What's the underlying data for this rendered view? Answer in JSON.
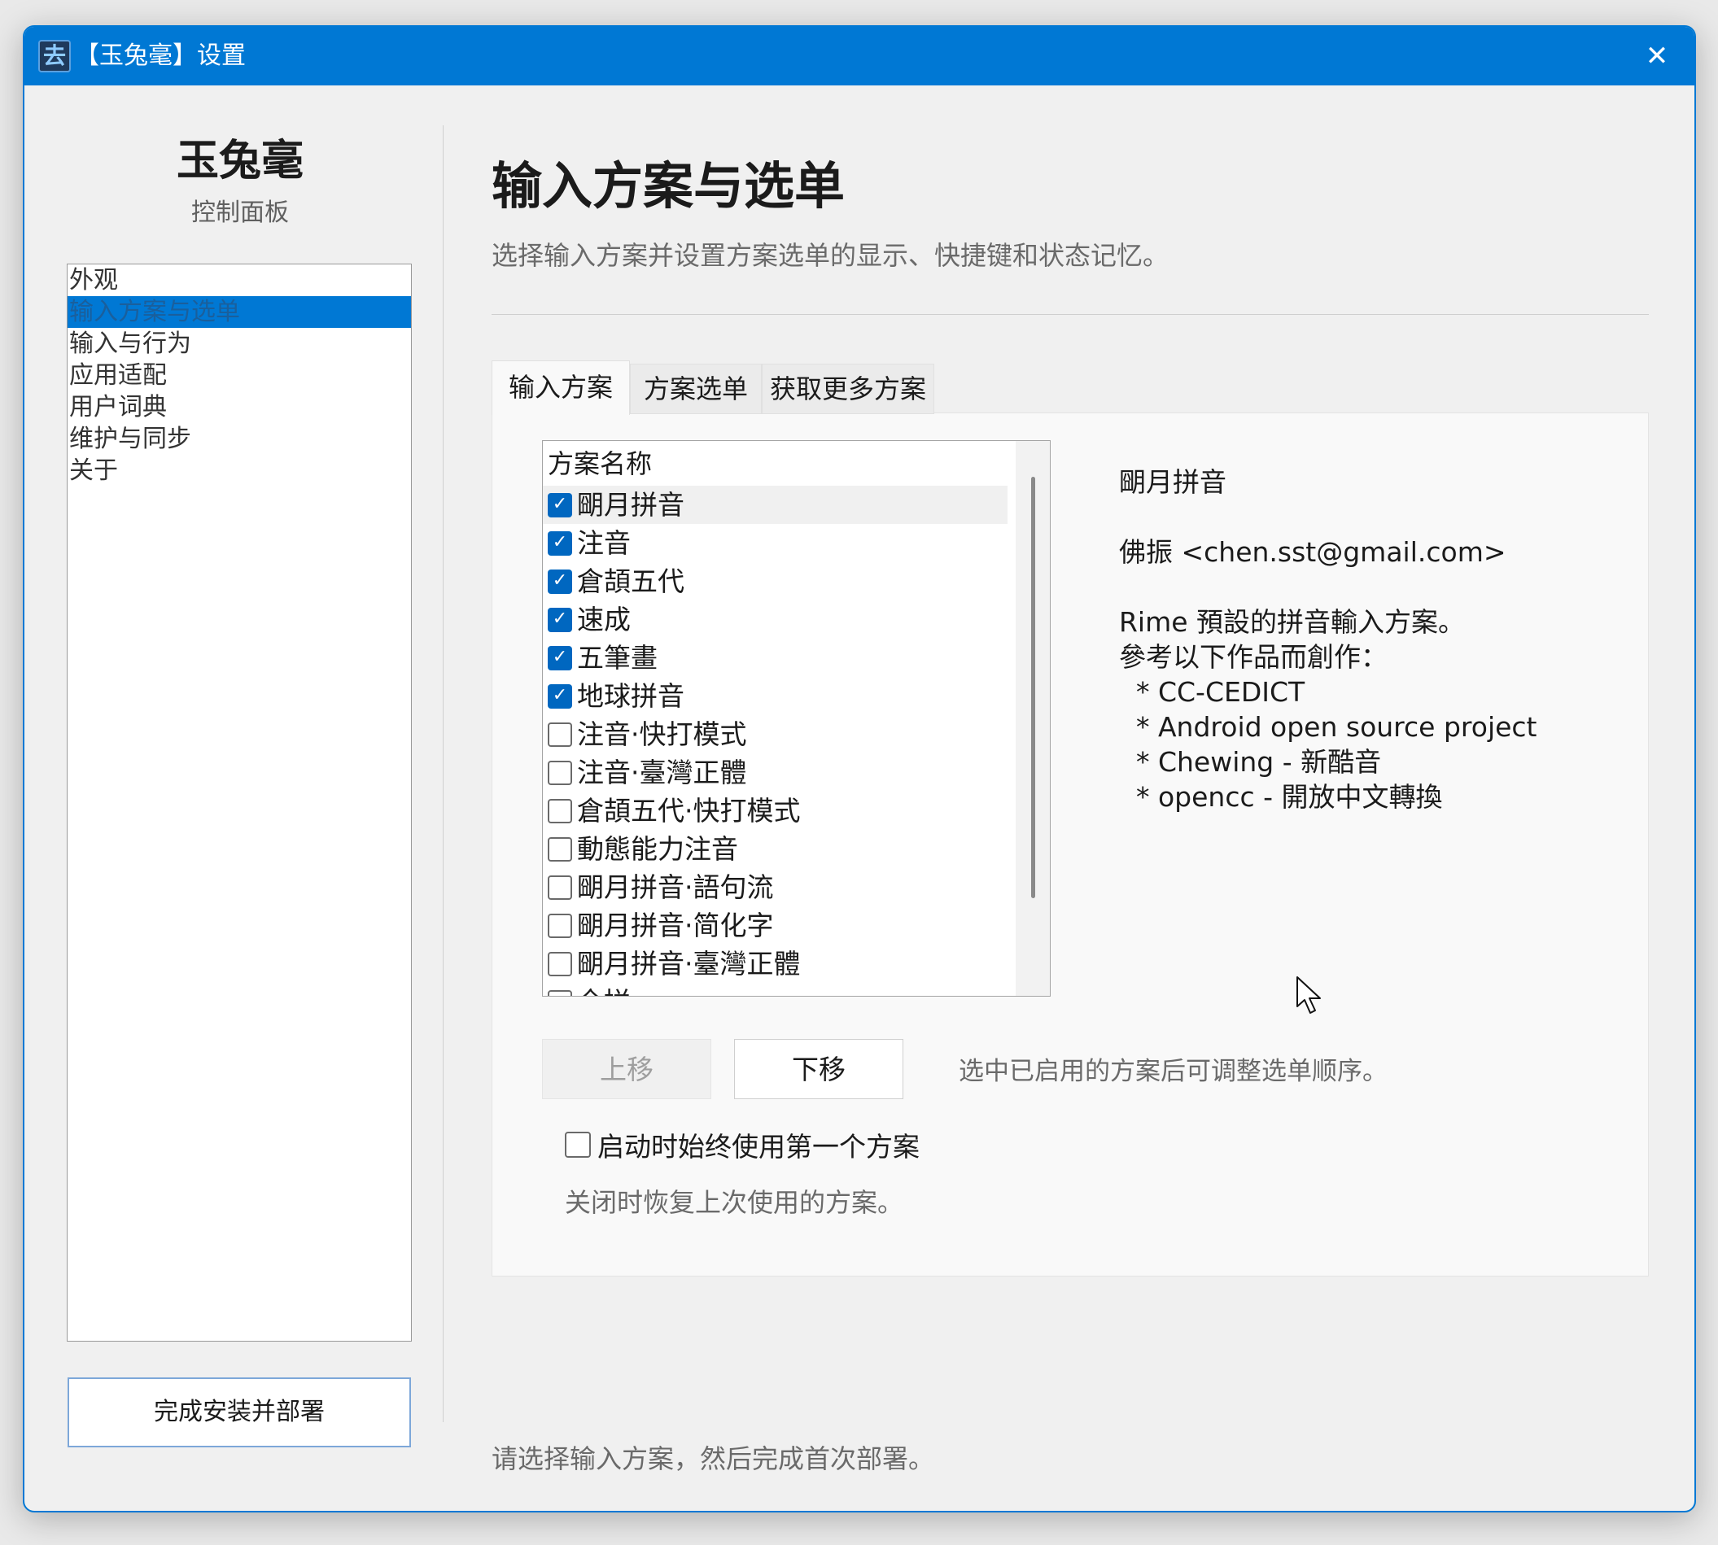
{
  "titlebar": {
    "icon_glyph": "去",
    "title": "【玉兔毫】设置",
    "close_glyph": "✕"
  },
  "sidebar": {
    "brand": "玉兔毫",
    "subtitle": "控制面板",
    "items": [
      {
        "label": "外观"
      },
      {
        "label": "输入方案与选单",
        "active": true
      },
      {
        "label": "输入与行为"
      },
      {
        "label": "应用适配"
      },
      {
        "label": "用户词典"
      },
      {
        "label": "维护与同步"
      },
      {
        "label": "关于"
      }
    ],
    "finish_button": "完成安装并部署"
  },
  "main": {
    "title": "输入方案与选单",
    "description": "选择输入方案并设置方案选单的显示、快捷键和状态记忆。",
    "tabs": [
      {
        "label": "输入方案",
        "active": true
      },
      {
        "label": "方案选单"
      },
      {
        "label": "获取更多方案"
      }
    ],
    "schema_list": {
      "header": "方案名称",
      "rows": [
        {
          "label": "朙月拼音",
          "checked": true
        },
        {
          "label": "注音",
          "checked": true
        },
        {
          "label": "倉頡五代",
          "checked": true
        },
        {
          "label": "速成",
          "checked": true
        },
        {
          "label": "五筆畫",
          "checked": true
        },
        {
          "label": "地球拼音",
          "checked": true
        },
        {
          "label": "注音·快打模式",
          "checked": false
        },
        {
          "label": "注音·臺灣正體",
          "checked": false
        },
        {
          "label": "倉頡五代·快打模式",
          "checked": false
        },
        {
          "label": "動態能力注音",
          "checked": false
        },
        {
          "label": "朙月拼音·語句流",
          "checked": false
        },
        {
          "label": "朙月拼音·简化字",
          "checked": false
        },
        {
          "label": "朙月拼音·臺灣正體",
          "checked": false
        },
        {
          "label": "全拼",
          "checked": false
        }
      ]
    },
    "detail": {
      "name": "朙月拼音",
      "author": "佛振 <chen.sst@gmail.com>",
      "desc_lines": [
        "Rime 預設的拼音輸入方案。",
        "參考以下作品而創作：",
        "  * CC-CEDICT",
        "  * Android open source project",
        "  * Chewing - 新酷音",
        "  * opencc - 開放中文轉換"
      ]
    },
    "move_up": "上移",
    "move_down": "下移",
    "order_hint": "选中已启用的方案后可调整选单顺序。",
    "startup_checkbox": {
      "label": "启动时始终使用第一个方案",
      "checked": false
    },
    "startup_desc": "关闭时恢复上次使用的方案。",
    "footer": "请选择输入方案，然后完成首次部署。"
  },
  "colors": {
    "accent": "#0078d4",
    "checkbox_on": "#0067c0",
    "window_bg": "#f0f0f0"
  }
}
